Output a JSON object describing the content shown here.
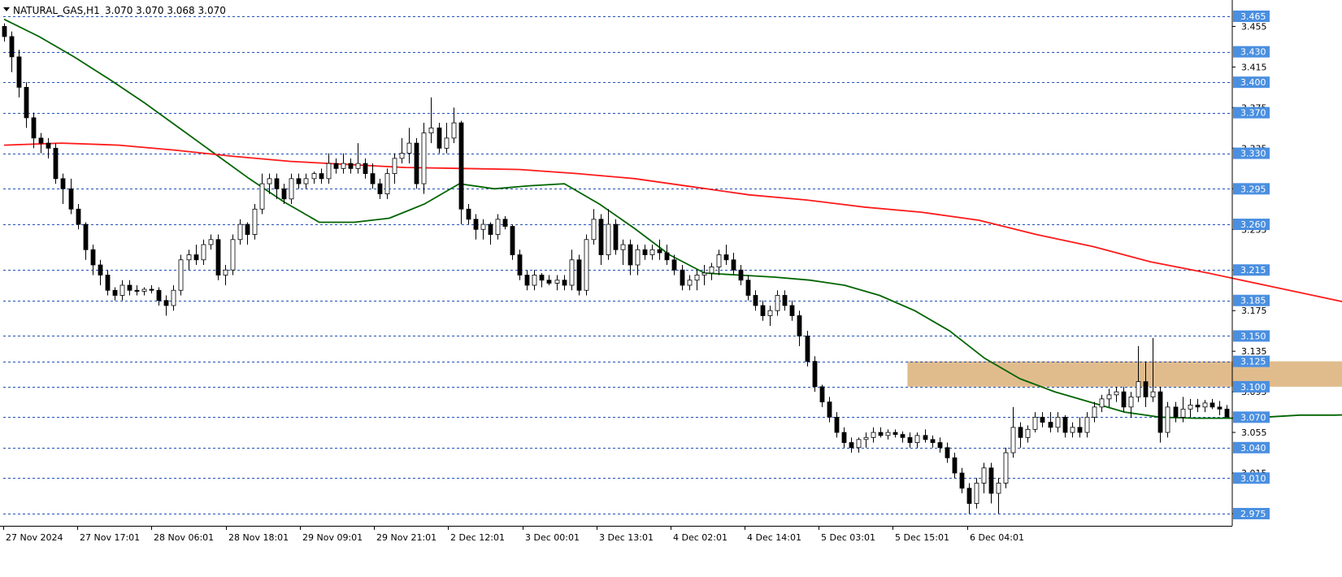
{
  "header": {
    "symbol_timeframe": "NATURAL_GAS,H1",
    "ohlc": "3.070 3.070 3.068 3.070"
  },
  "colors": {
    "background": "#ffffff",
    "grid": "#1f4fb5",
    "axis": "#000000",
    "ma_fast": "#006400",
    "ma_slow": "#ff1a1a",
    "zone_fill": "#deb887",
    "label_bg": "#4a8fe0",
    "label_text": "#ffffff",
    "candle_bull": "#ffffff",
    "candle_bear": "#000000"
  },
  "chart_data": {
    "type": "candlestick",
    "title": "NATURAL_GAS,H1",
    "timeframe": "H1",
    "ylim": [
      2.96,
      3.475
    ],
    "grid": "horizontal dashed at level lines",
    "legend": "none",
    "y_axis_ticks": [
      "3.455",
      "3.415",
      "3.375",
      "3.335",
      "3.295",
      "3.255",
      "3.215",
      "3.175",
      "3.135",
      "3.095",
      "3.055",
      "3.015",
      "2.975"
    ],
    "level_lines": [
      "3.465",
      "3.430",
      "3.400",
      "3.370",
      "3.330",
      "3.295",
      "3.260",
      "3.215",
      "3.185",
      "3.150",
      "3.125",
      "3.100",
      "3.070",
      "3.040",
      "3.010",
      "2.975"
    ],
    "x_axis_labels": [
      "27 Nov 2024",
      "27 Nov 17:01",
      "28 Nov 06:01",
      "28 Nov 18:01",
      "29 Nov 09:01",
      "29 Nov 21:01",
      "2 Dec 12:01",
      "3 Dec 00:01",
      "3 Dec 13:01",
      "4 Dec 02:01",
      "4 Dec 14:01",
      "5 Dec 03:01",
      "5 Dec 15:01",
      "6 Dec 04:01"
    ],
    "resistance_zone": {
      "low": 3.1,
      "high": 3.125,
      "from_bar": 123,
      "to_bar": 218
    },
    "candles_ohlc": [
      [
        3.455,
        3.458,
        3.44,
        3.445
      ],
      [
        3.445,
        3.45,
        3.41,
        3.425
      ],
      [
        3.425,
        3.432,
        3.385,
        3.395
      ],
      [
        3.395,
        3.4,
        3.355,
        3.365
      ],
      [
        3.365,
        3.37,
        3.335,
        3.345
      ],
      [
        3.345,
        3.35,
        3.33,
        3.34
      ],
      [
        3.34,
        3.345,
        3.325,
        3.335
      ],
      [
        3.335,
        3.34,
        3.3,
        3.305
      ],
      [
        3.305,
        3.31,
        3.28,
        3.295
      ],
      [
        3.295,
        3.305,
        3.27,
        3.275
      ],
      [
        3.275,
        3.28,
        3.255,
        3.26
      ],
      [
        3.26,
        3.262,
        3.225,
        3.235
      ],
      [
        3.235,
        3.24,
        3.21,
        3.22
      ],
      [
        3.22,
        3.225,
        3.2,
        3.21
      ],
      [
        3.21,
        3.215,
        3.19,
        3.195
      ],
      [
        3.195,
        3.198,
        3.185,
        3.19
      ],
      [
        3.19,
        3.205,
        3.185,
        3.2
      ],
      [
        3.2,
        3.205,
        3.19,
        3.195
      ],
      [
        3.195,
        3.2,
        3.19,
        3.194
      ],
      [
        3.194,
        3.198,
        3.19,
        3.196
      ],
      [
        3.196,
        3.2,
        3.192,
        3.195
      ],
      [
        3.195,
        3.198,
        3.18,
        3.185
      ],
      [
        3.185,
        3.19,
        3.17,
        3.18
      ],
      [
        3.18,
        3.2,
        3.175,
        3.195
      ],
      [
        3.195,
        3.23,
        3.19,
        3.225
      ],
      [
        3.225,
        3.235,
        3.215,
        3.23
      ],
      [
        3.23,
        3.24,
        3.22,
        3.225
      ],
      [
        3.225,
        3.245,
        3.22,
        3.24
      ],
      [
        3.24,
        3.25,
        3.235,
        3.245
      ],
      [
        3.245,
        3.25,
        3.205,
        3.21
      ],
      [
        3.21,
        3.22,
        3.2,
        3.215
      ],
      [
        3.215,
        3.25,
        3.21,
        3.245
      ],
      [
        3.245,
        3.265,
        3.24,
        3.26
      ],
      [
        3.26,
        3.262,
        3.24,
        3.25
      ],
      [
        3.25,
        3.28,
        3.245,
        3.275
      ],
      [
        3.275,
        3.31,
        3.27,
        3.3
      ],
      [
        3.3,
        3.31,
        3.29,
        3.305
      ],
      [
        3.305,
        3.31,
        3.285,
        3.295
      ],
      [
        3.295,
        3.3,
        3.28,
        3.285
      ],
      [
        3.285,
        3.31,
        3.28,
        3.305
      ],
      [
        3.305,
        3.31,
        3.295,
        3.3
      ],
      [
        3.3,
        3.31,
        3.295,
        3.305
      ],
      [
        3.305,
        3.312,
        3.3,
        3.31
      ],
      [
        3.31,
        3.315,
        3.3,
        3.305
      ],
      [
        3.305,
        3.33,
        3.3,
        3.32
      ],
      [
        3.32,
        3.325,
        3.31,
        3.315
      ],
      [
        3.315,
        3.33,
        3.31,
        3.32
      ],
      [
        3.32,
        3.325,
        3.31,
        3.315
      ],
      [
        3.315,
        3.34,
        3.31,
        3.32
      ],
      [
        3.32,
        3.325,
        3.305,
        3.31
      ],
      [
        3.31,
        3.32,
        3.295,
        3.3
      ],
      [
        3.3,
        3.305,
        3.285,
        3.29
      ],
      [
        3.29,
        3.315,
        3.285,
        3.31
      ],
      [
        3.31,
        3.33,
        3.3,
        3.325
      ],
      [
        3.325,
        3.345,
        3.32,
        3.33
      ],
      [
        3.33,
        3.355,
        3.32,
        3.34
      ],
      [
        3.34,
        3.345,
        3.295,
        3.3
      ],
      [
        3.3,
        3.36,
        3.29,
        3.35
      ],
      [
        3.35,
        3.385,
        3.34,
        3.355
      ],
      [
        3.355,
        3.36,
        3.33,
        3.335
      ],
      [
        3.335,
        3.36,
        3.33,
        3.345
      ],
      [
        3.345,
        3.375,
        3.34,
        3.36
      ],
      [
        3.36,
        3.362,
        3.26,
        3.275
      ],
      [
        3.275,
        3.28,
        3.26,
        3.265
      ],
      [
        3.265,
        3.27,
        3.245,
        3.255
      ],
      [
        3.255,
        3.265,
        3.245,
        3.26
      ],
      [
        3.26,
        3.262,
        3.24,
        3.25
      ],
      [
        3.25,
        3.27,
        3.245,
        3.265
      ],
      [
        3.265,
        3.268,
        3.255,
        3.258
      ],
      [
        3.258,
        3.26,
        3.225,
        3.23
      ],
      [
        3.23,
        3.235,
        3.205,
        3.21
      ],
      [
        3.21,
        3.215,
        3.195,
        3.2
      ],
      [
        3.2,
        3.215,
        3.195,
        3.21
      ],
      [
        3.21,
        3.212,
        3.198,
        3.205
      ],
      [
        3.205,
        3.21,
        3.2,
        3.202
      ],
      [
        3.202,
        3.21,
        3.195,
        3.205
      ],
      [
        3.205,
        3.21,
        3.195,
        3.2
      ],
      [
        3.2,
        3.235,
        3.195,
        3.225
      ],
      [
        3.225,
        3.23,
        3.19,
        3.195
      ],
      [
        3.195,
        3.25,
        3.19,
        3.245
      ],
      [
        3.245,
        3.275,
        3.24,
        3.265
      ],
      [
        3.265,
        3.27,
        3.22,
        3.23
      ],
      [
        3.23,
        3.275,
        3.225,
        3.26
      ],
      [
        3.26,
        3.265,
        3.23,
        3.235
      ],
      [
        3.235,
        3.245,
        3.22,
        3.24
      ],
      [
        3.24,
        3.245,
        3.21,
        3.22
      ],
      [
        3.22,
        3.24,
        3.21,
        3.235
      ],
      [
        3.235,
        3.24,
        3.225,
        3.23
      ],
      [
        3.23,
        3.24,
        3.225,
        3.235
      ],
      [
        3.235,
        3.245,
        3.225,
        3.232
      ],
      [
        3.232,
        3.24,
        3.22,
        3.225
      ],
      [
        3.225,
        3.23,
        3.21,
        3.215
      ],
      [
        3.215,
        3.22,
        3.195,
        3.2
      ],
      [
        3.2,
        3.21,
        3.195,
        3.205
      ],
      [
        3.205,
        3.215,
        3.195,
        3.21
      ],
      [
        3.21,
        3.22,
        3.2,
        3.212
      ],
      [
        3.212,
        3.222,
        3.205,
        3.218
      ],
      [
        3.218,
        3.235,
        3.21,
        3.23
      ],
      [
        3.23,
        3.24,
        3.22,
        3.225
      ],
      [
        3.225,
        3.232,
        3.21,
        3.215
      ],
      [
        3.215,
        3.22,
        3.2,
        3.205
      ],
      [
        3.205,
        3.21,
        3.185,
        3.19
      ],
      [
        3.19,
        3.195,
        3.175,
        3.18
      ],
      [
        3.18,
        3.185,
        3.165,
        3.17
      ],
      [
        3.17,
        3.18,
        3.16,
        3.175
      ],
      [
        3.175,
        3.195,
        3.17,
        3.19
      ],
      [
        3.19,
        3.195,
        3.175,
        3.18
      ],
      [
        3.18,
        3.185,
        3.165,
        3.17
      ],
      [
        3.17,
        3.175,
        3.14,
        3.15
      ],
      [
        3.15,
        3.155,
        3.12,
        3.125
      ],
      [
        3.125,
        3.13,
        3.095,
        3.1
      ],
      [
        3.1,
        3.102,
        3.08,
        3.085
      ],
      [
        3.085,
        3.09,
        3.065,
        3.07
      ],
      [
        3.07,
        3.075,
        3.05,
        3.055
      ],
      [
        3.055,
        3.06,
        3.04,
        3.045
      ],
      [
        3.045,
        3.05,
        3.035,
        3.04
      ],
      [
        3.04,
        3.05,
        3.035,
        3.048
      ],
      [
        3.048,
        3.055,
        3.04,
        3.05
      ],
      [
        3.05,
        3.06,
        3.045,
        3.055
      ],
      [
        3.055,
        3.06,
        3.05,
        3.052
      ],
      [
        3.052,
        3.058,
        3.048,
        3.055
      ],
      [
        3.055,
        3.058,
        3.05,
        3.053
      ],
      [
        3.053,
        3.056,
        3.045,
        3.05
      ],
      [
        3.05,
        3.055,
        3.04,
        3.045
      ],
      [
        3.045,
        3.055,
        3.04,
        3.052
      ],
      [
        3.052,
        3.058,
        3.045,
        3.048
      ],
      [
        3.048,
        3.052,
        3.04,
        3.045
      ],
      [
        3.045,
        3.05,
        3.035,
        3.04
      ],
      [
        3.04,
        3.045,
        3.025,
        3.03
      ],
      [
        3.03,
        3.035,
        3.01,
        3.015
      ],
      [
        3.015,
        3.02,
        2.995,
        3.0
      ],
      [
        3.0,
        3.005,
        2.975,
        2.985
      ],
      [
        2.985,
        3.01,
        2.98,
        3.005
      ],
      [
        3.005,
        3.025,
        2.995,
        3.02
      ],
      [
        3.02,
        3.025,
        2.985,
        2.995
      ],
      [
        2.995,
        3.01,
        2.975,
        3.005
      ],
      [
        3.005,
        3.04,
        3.0,
        3.035
      ],
      [
        3.035,
        3.08,
        3.03,
        3.06
      ],
      [
        3.06,
        3.065,
        3.04,
        3.05
      ],
      [
        3.05,
        3.062,
        3.045,
        3.058
      ],
      [
        3.058,
        3.075,
        3.055,
        3.07
      ],
      [
        3.07,
        3.075,
        3.06,
        3.065
      ],
      [
        3.065,
        3.075,
        3.055,
        3.06
      ],
      [
        3.06,
        3.075,
        3.055,
        3.07
      ],
      [
        3.07,
        3.072,
        3.05,
        3.055
      ],
      [
        3.055,
        3.065,
        3.05,
        3.06
      ],
      [
        3.06,
        3.07,
        3.05,
        3.055
      ],
      [
        3.055,
        3.075,
        3.05,
        3.07
      ],
      [
        3.07,
        3.085,
        3.065,
        3.08
      ],
      [
        3.08,
        3.092,
        3.075,
        3.088
      ],
      [
        3.088,
        3.098,
        3.08,
        3.092
      ],
      [
        3.092,
        3.1,
        3.085,
        3.095
      ],
      [
        3.095,
        3.1,
        3.075,
        3.08
      ],
      [
        3.08,
        3.095,
        3.07,
        3.09
      ],
      [
        3.09,
        3.14,
        3.085,
        3.105
      ],
      [
        3.105,
        3.125,
        3.08,
        3.09
      ],
      [
        3.09,
        3.148,
        3.085,
        3.095
      ],
      [
        3.095,
        3.1,
        3.045,
        3.055
      ],
      [
        3.055,
        3.085,
        3.05,
        3.08
      ],
      [
        3.08,
        3.085,
        3.065,
        3.07
      ],
      [
        3.07,
        3.09,
        3.065,
        3.078
      ],
      [
        3.078,
        3.088,
        3.07,
        3.082
      ],
      [
        3.082,
        3.088,
        3.075,
        3.08
      ],
      [
        3.08,
        3.087,
        3.075,
        3.084
      ],
      [
        3.084,
        3.088,
        3.078,
        3.08
      ],
      [
        3.08,
        3.086,
        3.072,
        3.078
      ],
      [
        3.078,
        3.082,
        3.07,
        3.07
      ]
    ],
    "series": [
      {
        "name": "",
        "type": "line",
        "values": [
          3.462,
          3.445,
          3.425,
          3.403,
          3.38,
          3.355,
          3.33,
          3.305,
          3.282,
          3.262,
          3.262,
          3.266,
          3.28,
          3.3,
          3.295,
          3.298,
          3.3,
          3.28,
          3.256,
          3.23,
          3.212,
          3.21,
          3.208,
          3.205,
          3.2,
          3.19,
          3.175,
          3.155,
          3.128,
          3.108,
          3.095,
          3.085,
          3.075,
          3.07,
          3.069,
          3.069,
          3.07,
          3.072,
          3.072,
          3.073,
          3.075,
          3.078,
          3.08,
          3.078,
          3.078,
          3.077
        ]
      },
      {
        "name": "",
        "type": "line",
        "values": [
          3.338,
          3.34,
          3.338,
          3.333,
          3.327,
          3.322,
          3.319,
          3.316,
          3.315,
          3.314,
          3.31,
          3.305,
          3.297,
          3.289,
          3.284,
          3.277,
          3.272,
          3.264,
          3.25,
          3.238,
          3.223,
          3.212,
          3.2,
          3.188,
          3.176,
          3.167,
          3.159,
          3.153,
          3.149
        ]
      }
    ]
  }
}
